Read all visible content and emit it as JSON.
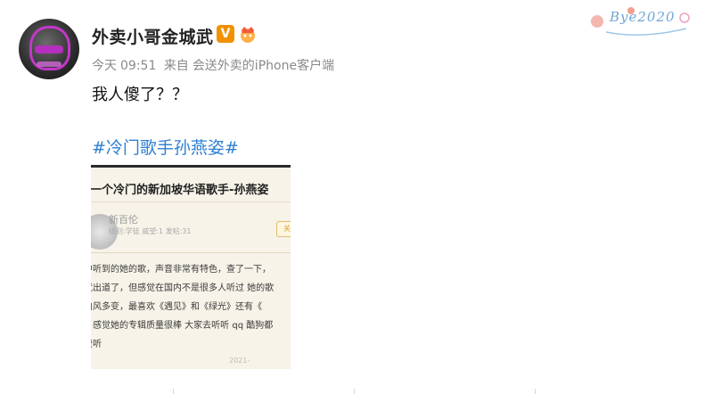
{
  "post": {
    "username": "外卖小哥金城武",
    "vip_badge": "V",
    "meta": {
      "time_prefix": "今天",
      "time": "09:51",
      "source_prefix": "来自",
      "source": "会送外卖的iPhone客户端"
    },
    "text": "我人傻了？？",
    "hashtag": "#冷门歌手孙燕姿#",
    "decoration_text": "Bye2020",
    "image": {
      "title": "荐一个冷门的新加坡华语歌手-孙燕姿",
      "author": "新百伦",
      "author_sub": "级别:学徒  威望:1  发帖:31",
      "author_dot": "-",
      "tag": "关",
      "lines": [
        "中听到的她的歌，声音非常有特色，查了一下，",
        "就出道了，但感觉在国内不是很多人听过 她的歌",
        "曲风多变，最喜欢《遇见》和《绿光》还有《",
        "》感觉她的专辑质量很棒 大家去听听 qq 酷狗都",
        "费听"
      ],
      "footer": "2021-"
    }
  },
  "colors": {
    "hashtag": "#2e7fd1",
    "vip_badge": "#f29100",
    "meta": "#8a8a8a"
  }
}
